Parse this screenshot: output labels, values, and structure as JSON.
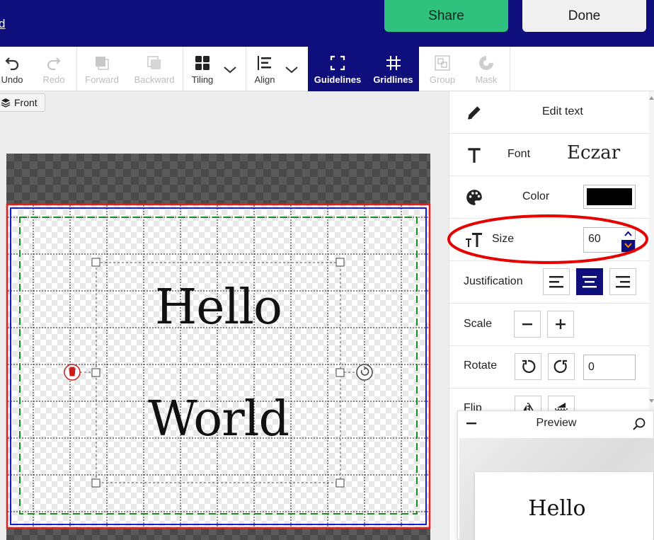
{
  "header": {
    "link_text": "d",
    "share_label": "Share",
    "done_label": "Done"
  },
  "toolbar": {
    "undo": "Undo",
    "redo": "Redo",
    "forward": "Forward",
    "backward": "Backward",
    "tiling": "Tiling",
    "align": "Align",
    "guidelines": "Guidelines",
    "gridlines": "Gridlines",
    "group": "Group",
    "mask": "Mask"
  },
  "layer_chip": "Front",
  "canvas": {
    "line1": "Hello",
    "line2": "World"
  },
  "panel": {
    "edit_text": "Edit text",
    "font_label": "Font",
    "font_value": "Eczar",
    "color_label": "Color",
    "color_value": "#000000",
    "size_label": "Size",
    "size_value": "60",
    "justification_label": "Justification",
    "scale_label": "Scale",
    "rotate_label": "Rotate",
    "rotate_value": "0",
    "flip_label": "Flip"
  },
  "preview": {
    "title": "Preview",
    "text": "Hello"
  },
  "colors": {
    "brand": "#0e0e7c",
    "share": "#2ec27e",
    "highlight": "#e60000"
  },
  "icons": [
    "undo-icon",
    "redo-icon",
    "forward-icon",
    "backward-icon",
    "tiling-icon",
    "align-icon",
    "guidelines-icon",
    "gridlines-icon",
    "group-icon",
    "mask-icon",
    "pencil-icon",
    "text-icon",
    "palette-icon",
    "text-size-icon",
    "search-icon"
  ]
}
